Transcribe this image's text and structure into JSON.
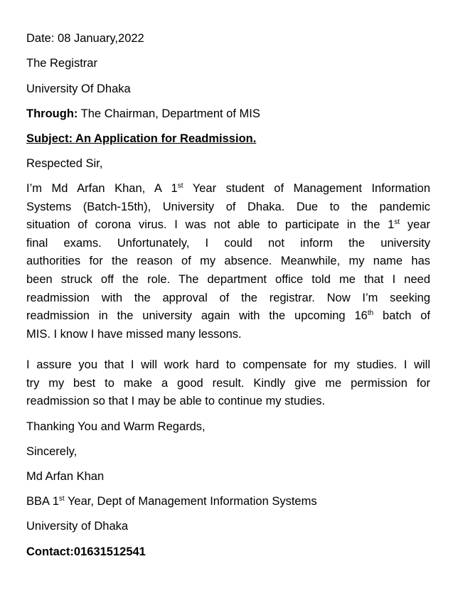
{
  "letter": {
    "date": "Date: 08 January,2022",
    "recipient": "The Registrar",
    "university": "University Of Dhaka",
    "through_label": "Through:",
    "through_text": " The Chairman, Department of MIS",
    "subject": "Subject: An Application for Readmission.",
    "salutation": "Respected Sir,",
    "para1": {
      "l1a": "I’m Md Arfan Khan, A 1",
      "l1sup": "st",
      "l1b": " Year student of Management Information",
      "l2": "Systems (Batch-15th), University of Dhaka. Due to the pandemic",
      "l3a": "situation of corona virus. I was not able to participate in the 1",
      "l3sup": "st",
      "l3b": " year",
      "l4": "final exams. Unfortunately, I could not inform the university",
      "l5": "authorities for the reason of my absence. Meanwhile, my name has",
      "l6": "been struck off the role. The department office told me that I need",
      "l7": "readmission with the approval of the registrar. Now I’m seeking",
      "l8a": "readmission in the university again with the upcoming 16",
      "l8sup": "th",
      "l8b": " batch of",
      "l9": "MIS. I know I have missed many lessons."
    },
    "para2": {
      "l1": " I assure you that I will work hard to compensate for my studies. I will",
      "l2": "try my best to make a good result. Kindly give me permission for",
      "l3": "readmission so that I may be able to continue my studies."
    },
    "closing": "Thanking You and Warm Regards,",
    "sign_off": "Sincerely,",
    "name": "Md Arfan Khan",
    "position_a": "BBA 1",
    "position_sup": "st",
    "position_b": " Year, Dept of Management Information Systems",
    "signature_university": "University of Dhaka",
    "contact": "Contact:01631512541"
  }
}
